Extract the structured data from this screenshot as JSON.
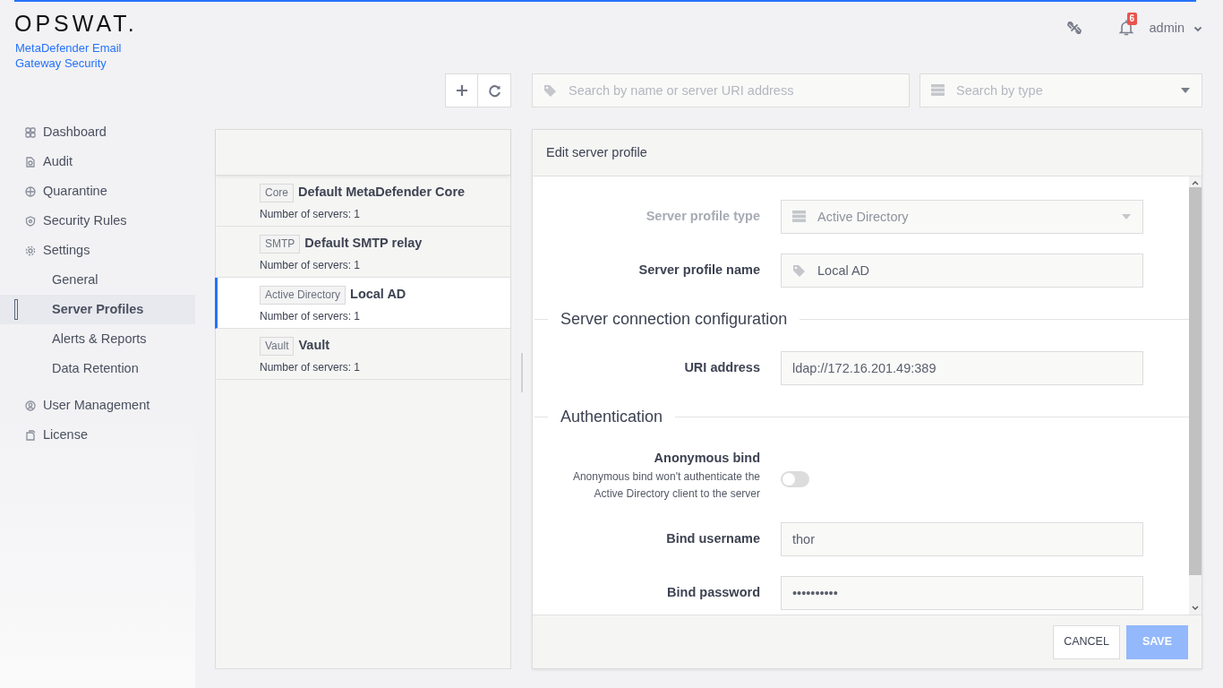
{
  "brand": {
    "logo": "OPSWAT.",
    "product": "MetaDefender Email Gateway Security"
  },
  "header": {
    "notifications": "6",
    "user": "admin"
  },
  "sidebar": {
    "items": [
      {
        "label": "Dashboard",
        "selected": false
      },
      {
        "label": "Audit",
        "selected": false
      },
      {
        "label": "Quarantine",
        "selected": false
      },
      {
        "label": "Security Rules",
        "selected": false
      },
      {
        "label": "Settings",
        "selected": false,
        "children": [
          {
            "label": "General",
            "selected": false
          },
          {
            "label": "Server Profiles",
            "selected": true
          },
          {
            "label": "Alerts & Reports",
            "selected": false
          },
          {
            "label": "Data Retention",
            "selected": false
          }
        ]
      },
      {
        "label": "User Management",
        "selected": false
      },
      {
        "label": "License",
        "selected": false
      }
    ]
  },
  "toolbar": {
    "search": {
      "placeholder": "Search by name or server URI address"
    },
    "type_filter": {
      "placeholder": "Search by type"
    }
  },
  "profiles": [
    {
      "type": "Core",
      "name": "Default MetaDefender Core",
      "servers": "Number of servers: 1",
      "selected": false
    },
    {
      "type": "SMTP",
      "name": "Default SMTP relay",
      "servers": "Number of servers: 1",
      "selected": false
    },
    {
      "type": "Active Directory",
      "name": "Local AD",
      "servers": "Number of servers: 1",
      "selected": true
    },
    {
      "type": "Vault",
      "name": "Vault",
      "servers": "Number of servers: 1",
      "selected": false
    }
  ],
  "editor": {
    "title": "Edit server profile",
    "rows": [
      {
        "kind": "select",
        "label": "Server profile type",
        "value": "Active Directory",
        "disabled": true
      },
      {
        "kind": "tag-input",
        "label": "Server profile name",
        "value": "Local AD"
      },
      {
        "kind": "heading",
        "label": "Server connection configuration"
      },
      {
        "kind": "input",
        "label": "URI address",
        "value": "ldap://172.16.201.49:389"
      },
      {
        "kind": "heading",
        "label": "Authentication"
      },
      {
        "kind": "toggle",
        "label": "Anonymous bind",
        "help": "Anonymous bind won't authenticate the Active Directory client to the server",
        "on": false
      },
      {
        "kind": "input",
        "label": "Bind username",
        "value": "thor"
      },
      {
        "kind": "input",
        "label": "Bind password",
        "value": "••••••••••"
      }
    ],
    "buttons": [
      {
        "label": "CANCEL",
        "disabled": false
      },
      {
        "label": "SAVE",
        "disabled": true
      }
    ]
  }
}
